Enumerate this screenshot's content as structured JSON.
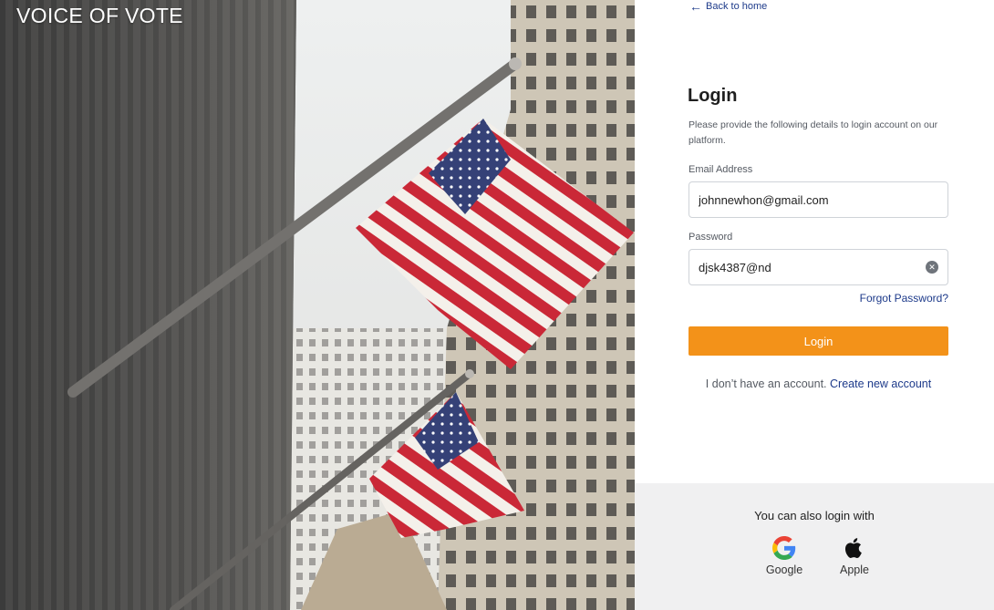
{
  "brand": {
    "name": "VOICE OF VOTE"
  },
  "nav": {
    "back_label": "Back to home"
  },
  "login": {
    "title": "Login",
    "subtitle": "Please provide the following details to login account on our platform.",
    "email_label": "Email Address",
    "email_value": "johnnewhon@gmail.com",
    "password_label": "Password",
    "password_value": "djsk4387@nd",
    "forgot_label": "Forgot Password?",
    "submit_label": "Login",
    "no_account_text": "I don’t have an account.",
    "create_account_label": "Create new account"
  },
  "social": {
    "title": "You can also login with",
    "providers": [
      {
        "label": "Google",
        "icon": "google-icon"
      },
      {
        "label": "Apple",
        "icon": "apple-icon"
      }
    ]
  },
  "colors": {
    "accent": "#f39219",
    "link": "#1d3a8a",
    "social_bg": "#f0f0f1"
  }
}
